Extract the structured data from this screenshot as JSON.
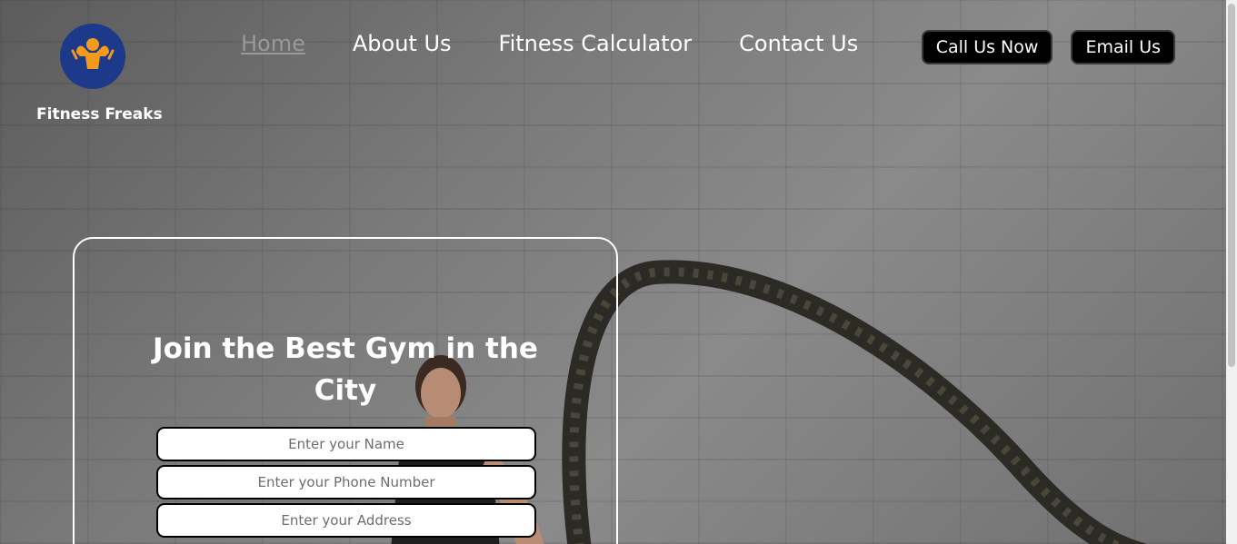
{
  "brand": {
    "name": "Fitness Freaks",
    "logo_icon": "flexing-man-icon",
    "logo_bg": "#1d3a8a",
    "logo_figure": "#f39a1e"
  },
  "nav": {
    "items": [
      {
        "label": "Home",
        "active": true
      },
      {
        "label": "About Us",
        "active": false
      },
      {
        "label": "Fitness Calculator",
        "active": false
      },
      {
        "label": "Contact Us",
        "active": false
      }
    ]
  },
  "cta": {
    "call_label": "Call Us Now",
    "email_label": "Email Us"
  },
  "join": {
    "title": "Join the Best Gym in the City",
    "fields": {
      "name_placeholder": "Enter your Name",
      "phone_placeholder": "Enter your Phone Number",
      "address_placeholder": "Enter your Address"
    }
  },
  "colors": {
    "text": "#ffffff",
    "nav_active": "#9a9a9a",
    "button_bg": "#000000"
  }
}
